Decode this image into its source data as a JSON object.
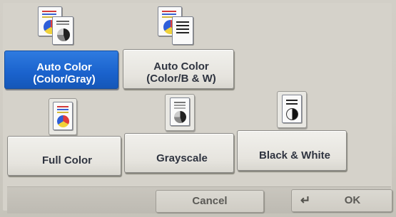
{
  "color_modes": {
    "auto_color_gray": {
      "line1": "Auto Color",
      "line2": "(Color/Gray)",
      "selected": true
    },
    "auto_color_bw": {
      "line1": "Auto Color",
      "line2": "(Color/B & W)",
      "selected": false
    },
    "full_color": {
      "label": "Full Color",
      "selected": false
    },
    "grayscale": {
      "label": "Grayscale",
      "selected": false
    },
    "black_white": {
      "label": "Black & White",
      "selected": false
    }
  },
  "actions": {
    "cancel_label": "Cancel",
    "ok_label": "OK",
    "ok_icon": "enter-arrow-icon"
  },
  "colors": {
    "selected_blue": "#1a62cc",
    "button_face": "#ecebe6",
    "text_dark": "#2f3440"
  }
}
